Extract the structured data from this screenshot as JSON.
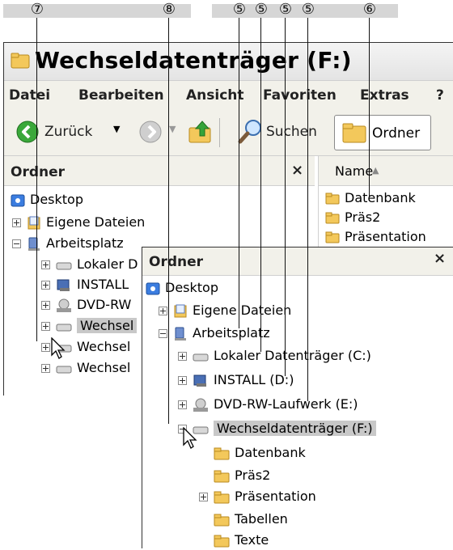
{
  "callouts": [
    "⑦",
    "⑧",
    "⑤",
    "⑤",
    "⑤",
    "⑤",
    "⑥"
  ],
  "window": {
    "title": "Wechseldatenträger (F:)",
    "menu": [
      "Datei",
      "Bearbeiten",
      "Ansicht",
      "Favoriten",
      "Extras",
      "?"
    ],
    "toolbar": {
      "back": "Zurück",
      "search": "Suchen",
      "folders": "Ordner"
    },
    "folders_pane": {
      "title": "Ordner",
      "close": "×"
    },
    "tree": [
      "Desktop",
      "Eigene Dateien",
      "Arbeitsplatz",
      "Lokaler D",
      "INSTALL",
      "DVD-RW",
      "Wechsel",
      "Wechsel",
      "Wechsel"
    ],
    "list": {
      "column": "Name",
      "items": [
        "Datenbank",
        "Präs2",
        "Präsentation"
      ]
    }
  },
  "overlay": {
    "title": "Ordner",
    "close": "×",
    "tree": {
      "desktop": "Desktop",
      "eigene": "Eigene Dateien",
      "arbeitsplatz": "Arbeitsplatz",
      "c": "Lokaler Datenträger (C:)",
      "d": "INSTALL (D:)",
      "e": "DVD-RW-Laufwerk (E:)",
      "f": "Wechseldatenträger (F:)",
      "f_children": [
        "Datenbank",
        "Präs2",
        "Präsentation",
        "Tabellen",
        "Texte"
      ]
    }
  }
}
